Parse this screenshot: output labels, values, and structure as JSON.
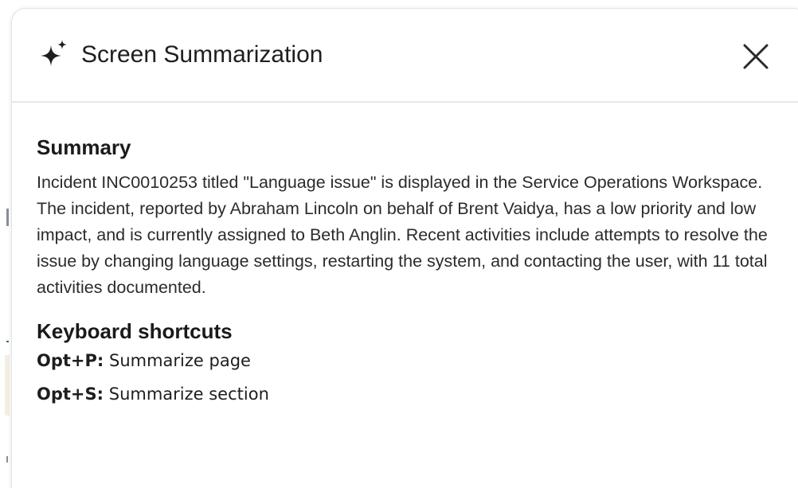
{
  "panel": {
    "title": "Screen Summarization",
    "title_icon": "sparkle-icon",
    "close_icon": "close-icon"
  },
  "summary": {
    "heading": "Summary",
    "text": "Incident INC0010253 titled \"Language issue\" is displayed in the Service Operations Workspace. The incident, reported by Abraham Lincoln on behalf of Brent Vaidya, has a low priority and low impact, and is currently assigned to Beth Anglin. Recent activities include attempts to resolve the issue by changing language settings, restarting the system, and contacting the user, with 11 total activities documented."
  },
  "shortcuts": {
    "heading": "Keyboard shortcuts",
    "items": [
      {
        "key": "Opt+P:",
        "action": "Summarize page"
      },
      {
        "key": "Opt+S:",
        "action": "Summarize section"
      }
    ]
  },
  "colors": {
    "text": "#1e1e1e",
    "divider": "#e4e8ec",
    "panel_border": "#dfe3e8"
  }
}
